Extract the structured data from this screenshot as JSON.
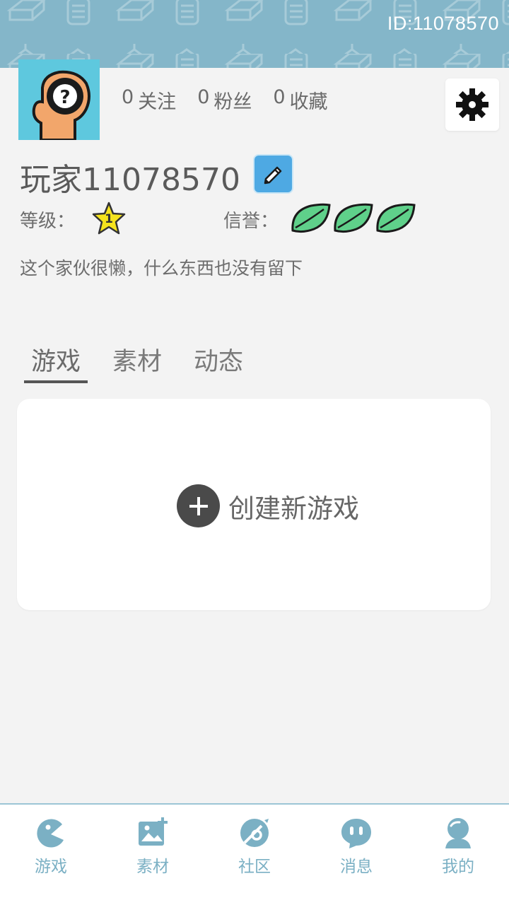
{
  "header": {
    "id_text": "ID:11078570"
  },
  "profile": {
    "stats": [
      {
        "count": "0",
        "label": "关注"
      },
      {
        "count": "0",
        "label": "粉丝"
      },
      {
        "count": "0",
        "label": "收藏"
      }
    ],
    "username": "玩家11078570",
    "level_label": "等级：",
    "level_value": "1",
    "credit_label": "信誉：",
    "credit_leaves": 3,
    "bio": "这个家伙很懒，什么东西也没有留下"
  },
  "tabs": [
    {
      "label": "游戏",
      "active": true
    },
    {
      "label": "素材",
      "active": false
    },
    {
      "label": "动态",
      "active": false
    }
  ],
  "create_card": {
    "label": "创建新游戏"
  },
  "bottom_nav": [
    {
      "label": "游戏",
      "icon": "pacman-icon"
    },
    {
      "label": "素材",
      "icon": "image-add-icon"
    },
    {
      "label": "社区",
      "icon": "compass-icon"
    },
    {
      "label": "消息",
      "icon": "chat-bubble-icon"
    },
    {
      "label": "我的",
      "icon": "user-icon"
    }
  ],
  "colors": {
    "banner": "#84b6c9",
    "nav_accent": "#7bb0c4",
    "avatar_bg": "#5ec8de",
    "edit_button": "#4ea9e3",
    "leaf": "#5fd08a",
    "star": "#f5e31d"
  }
}
